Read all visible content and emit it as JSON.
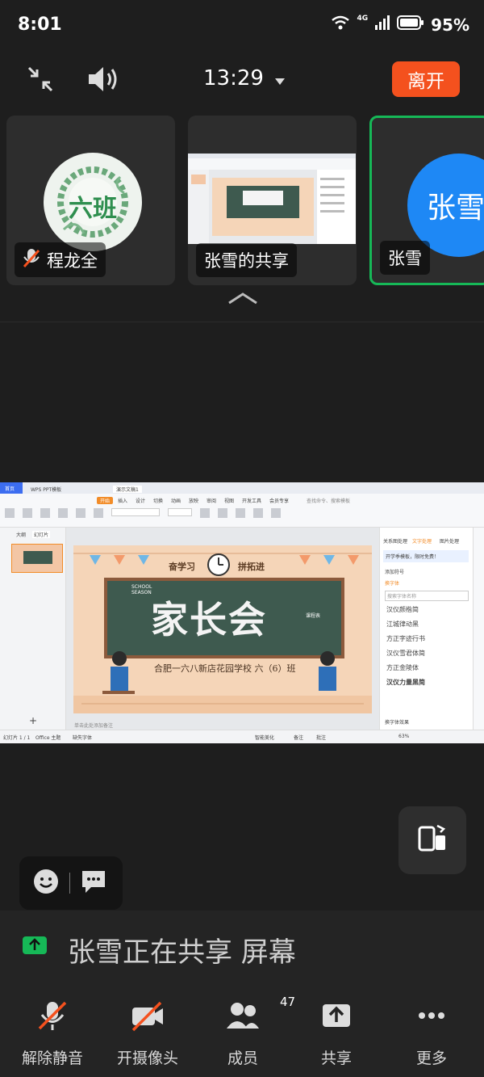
{
  "status_bar": {
    "time": "8:01",
    "network": "4G",
    "battery": "95%"
  },
  "top_bar": {
    "meeting_time": "13:29",
    "leave_label": "离开"
  },
  "participants": [
    {
      "name": "程龙全",
      "avatar_text": "六班",
      "muted": true
    },
    {
      "name": "张雪的共享",
      "avatar_text": "",
      "muted": false
    },
    {
      "name": "张雪",
      "avatar_text": "张雪",
      "muted": false,
      "active": true
    }
  ],
  "shared_screen": {
    "app_tabs": [
      "首页",
      "WPS PPT模板",
      "演示文稿1"
    ],
    "ribbon_tabs": [
      "开始",
      "插入",
      "设计",
      "切换",
      "动画",
      "放映",
      "审阅",
      "视图",
      "开发工具",
      "会员专享"
    ],
    "search_placeholder": "查找命令、搜索模板",
    "left_tabs": [
      "大纲",
      "幻灯片"
    ],
    "slide": {
      "header_left": "奋学习",
      "header_right": "拼拓进",
      "title": "家长会",
      "side_label": "SCHOOL SEASON",
      "board_label": "课程表",
      "subtitle": "合肥一六八新店花园学校 六（6）班"
    },
    "notes_hint": "单击此处添加备注",
    "right_panel": {
      "tabs": [
        "关系图处理",
        "文字处理",
        "图片处理"
      ],
      "notice": "开学季模板，限时免费！",
      "section1": "添加符号",
      "section2": "换字体",
      "search_placeholder": "搜索字体名称",
      "fonts": [
        "汉仪颜楷简",
        "江城律动黑",
        "方正字迹行书",
        "汉仪雪君体简",
        "方正金陵体",
        "汉仪力量黑简"
      ],
      "more": "换字体效果"
    },
    "status": {
      "slide_info": "幻灯片 1 / 1",
      "theme": "Office 主题",
      "missing_font": "缺失字体",
      "smart_beautify": "智能美化",
      "notes": "备注",
      "comments": "批注",
      "zoom": "63%"
    }
  },
  "share_banner": {
    "text": "张雪正在共享 屏幕"
  },
  "bottom_bar": {
    "items": [
      {
        "label": "解除静音",
        "icon": "mic-muted-icon"
      },
      {
        "label": "开摄像头",
        "icon": "camera-off-icon"
      },
      {
        "label": "成员",
        "icon": "members-icon",
        "count": "47"
      },
      {
        "label": "共享",
        "icon": "share-icon"
      },
      {
        "label": "更多",
        "icon": "more-icon"
      }
    ]
  },
  "colors": {
    "background": "#1e1e1e",
    "leave": "#f4511e",
    "active_speaker_border": "#16b857",
    "avatar_blue": "#1e88f5",
    "share_green": "#16b857"
  }
}
